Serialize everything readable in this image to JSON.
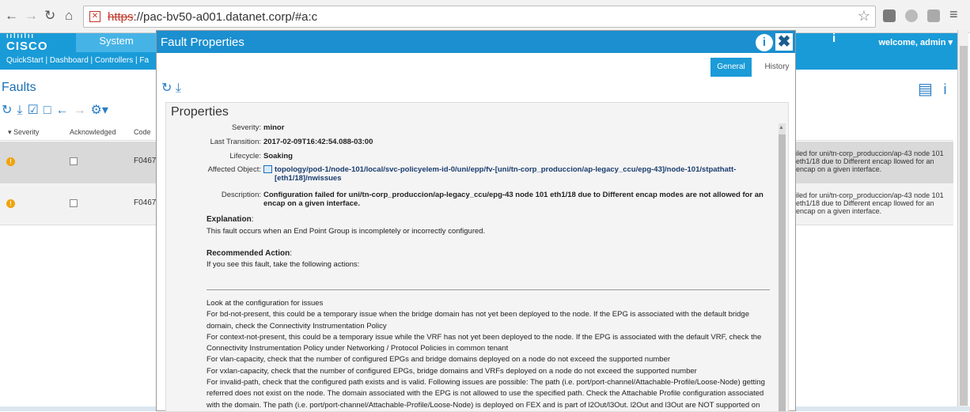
{
  "browser": {
    "url_prefix": "https",
    "url_rest": "://pac-bv50-a001.datanet.corp/#a:c"
  },
  "app": {
    "logo_text": "CISCO",
    "system_tab": "System",
    "info_label": "i",
    "welcome": "welcome, admin ▾",
    "subnav": "QuickStart  |  Dashboard  |  Controllers  |  Fa"
  },
  "faults": {
    "title": "Faults",
    "columns": [
      "▾  Severity",
      "Acknowledged",
      "Code"
    ],
    "rows": [
      {
        "code": "F0467",
        "desc": "iled for uni/tn-corp_produccion/ap-43 node 101 eth1/18 due to Different encap llowed for an encap on a given interface."
      },
      {
        "code": "F0467",
        "desc": "iled for uni/tn-corp_produccion/ap-43 node 101 eth1/18 due to Different encap llowed for an encap on a given interface."
      }
    ]
  },
  "dialog": {
    "title": "Fault Properties",
    "info_label": "i",
    "close_label": "✖",
    "tabs": {
      "general": "General",
      "history": "History"
    },
    "panel_title": "Properties",
    "fields": {
      "severity_label": "Severity:",
      "severity": "minor",
      "transition_label": "Last Transition:",
      "transition": "2017-02-09T16:42:54.088-03:00",
      "lifecycle_label": "Lifecycle:",
      "lifecycle": "Soaking",
      "affected_label": "Affected Object:",
      "affected": "topology/pod-1/node-101/local/svc-policyelem-id-0/uni/epp/fv-[uni/tn-corp_produccion/ap-legacy_ccu/epg-43]/node-101/stpathatt-[eth1/18]/nwissues",
      "description_label": "Description:",
      "description": "Configuration failed for uni/tn-corp_produccion/ap-legacy_ccu/epg-43 node 101 eth1/18 due to Different encap modes are not allowed for an encap on a given interface."
    },
    "explanation_label": "Explanation",
    "explanation": "This fault occurs when an End Point Group is incompletely or incorrectly configured.",
    "recommended_label": "Recommended Action",
    "recommended": "If you see this fault, take the following actions:",
    "lines": [
      "Look at the configuration for issues",
      "For bd-not-present, this could be a temporary issue when the bridge domain has not yet been deployed to the node. If the EPG is associated with the default bridge",
      "domain, check the Connectivity Instrumentation Policy",
      "For context-not-present, this could be a temporary issue while the VRF has not yet been deployed to the node. If the EPG is associated with the default VRF, check the",
      "Connectivity Instrumentation Policy under Networking / Protocol Policies in common tenant",
      "For vlan-capacity, check that the number of configured EPGs and bridge domains deployed on a node do not exceed the supported number",
      "For vxlan-capacity, check that the number of configured EPGs, bridge domains and VRFs deployed on a node do not exceed the supported number",
      "For invalid-path, check that the configured path exists and is valid. Following issues are possible: The path (i.e. port/port-channel/Attachable-Profile/Loose-Node) getting",
      "referred does not exist on the node. The domain associated with the EPG is not allowed to use the specified path. Check the Attachable Profile configuration associated",
      "with the domain. The path (i.e. port/port-channel/Attachable-Profile/Loose-Node) is deployed on FEX and is part of l2Out/l3Out. l2Out and l3Out are NOT supported on"
    ]
  }
}
